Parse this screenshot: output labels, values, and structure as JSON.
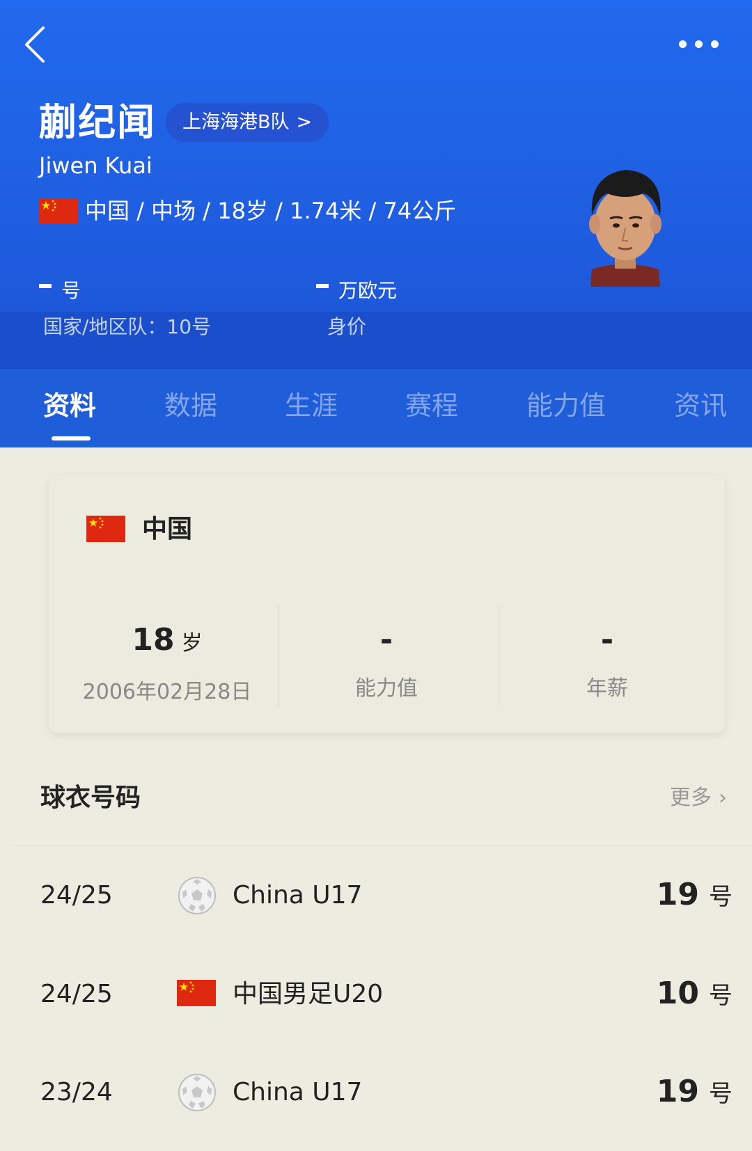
{
  "header": {
    "name_cn": "蒯纪闻",
    "team": "上海海港B队",
    "team_chevron": ">",
    "name_en": "Jiwen Kuai",
    "info": "中国 / 中场 / 18岁 / 1.74米 / 74公斤",
    "shirt_value": "号",
    "shirt_label": "国家/地区队：10号",
    "value_value": "万欧元",
    "value_label": "身价",
    "icons": [
      "back-icon",
      "more-icon",
      "flag-cn-icon"
    ]
  },
  "tabs": [
    {
      "label": "资料",
      "active": true
    },
    {
      "label": "数据",
      "active": false
    },
    {
      "label": "生涯",
      "active": false
    },
    {
      "label": "赛程",
      "active": false
    },
    {
      "label": "能力值",
      "active": false
    },
    {
      "label": "资讯",
      "active": false
    }
  ],
  "profile_card": {
    "country": "中国",
    "age_value": "18",
    "age_unit": "岁",
    "birthdate": "2006年02月28日",
    "ability_value": "-",
    "ability_label": "能力值",
    "salary_value": "-",
    "salary_label": "年薪"
  },
  "jersey": {
    "title": "球衣号码",
    "more": "更多",
    "more_chevron": "›",
    "rows": [
      {
        "season": "24/25",
        "team": "China U17",
        "number": "19",
        "unit": "号",
        "icon": "soccer-ball-icon"
      },
      {
        "season": "24/25",
        "team": "中国男足U20",
        "number": "10",
        "unit": "号",
        "icon": "flag-cn-icon"
      },
      {
        "season": "23/24",
        "team": "China U17",
        "number": "19",
        "unit": "号",
        "icon": "soccer-ball-icon"
      }
    ]
  },
  "colors": {
    "header_blue": "#2169ee",
    "tab_band_blue": "#1f5ed8",
    "page_bg": "#ecede0",
    "flag_red": "#de2910",
    "flag_star": "#ffde00"
  }
}
